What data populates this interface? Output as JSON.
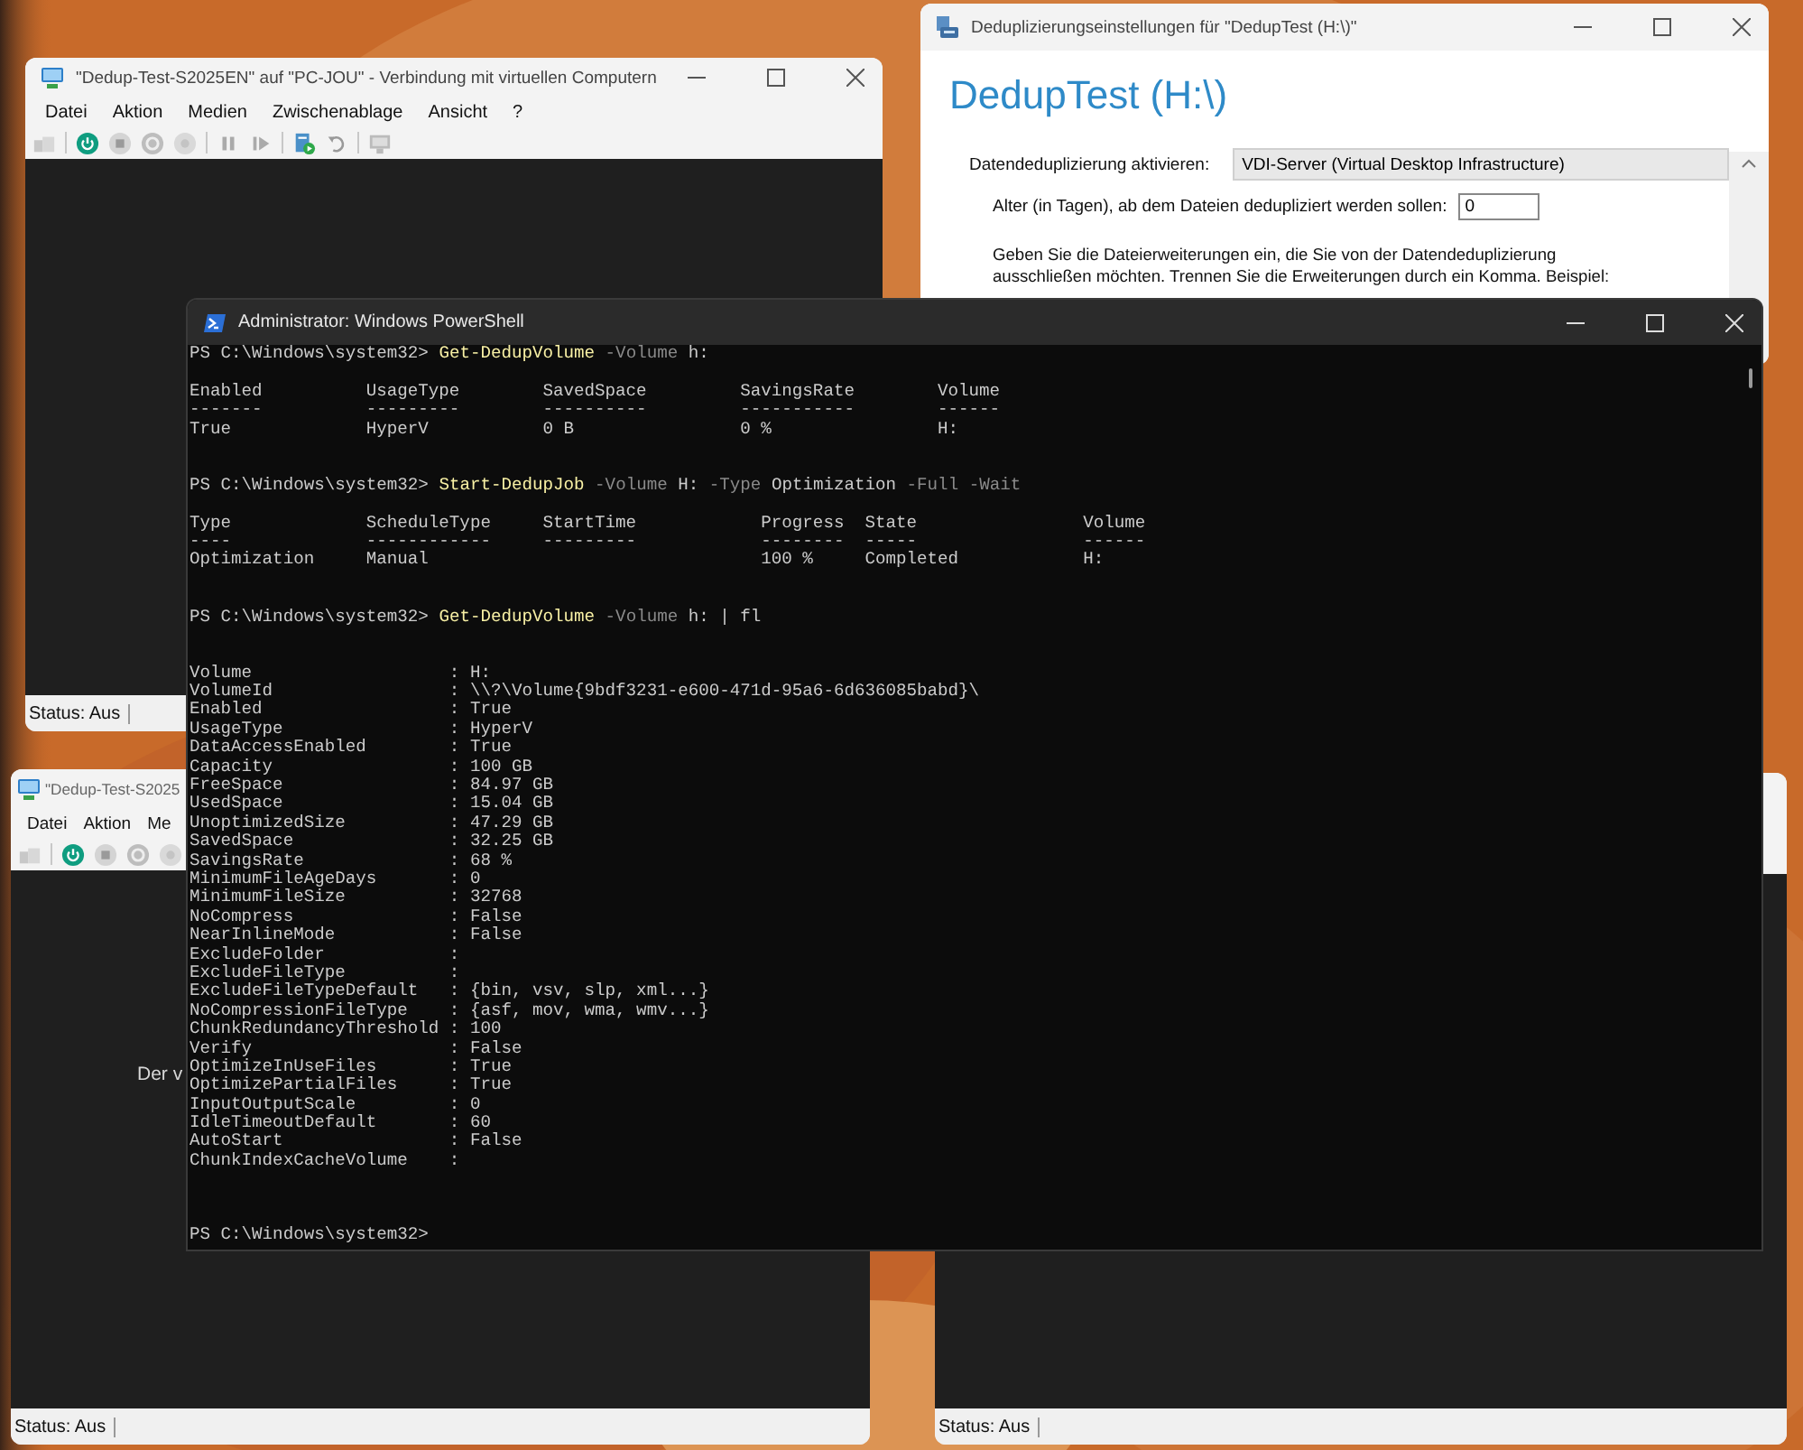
{
  "vm_top": {
    "title": "\"Dedup-Test-S2025EN\" auf \"PC-JOU\" - Verbindung mit virtuellen Computern",
    "menu": [
      "Datei",
      "Aktion",
      "Medien",
      "Zwischenablage",
      "Ansicht",
      "?"
    ],
    "status": "Status: Aus"
  },
  "vm_bottom_left": {
    "title": "\"Dedup-Test-S2025",
    "menu": [
      "Datei",
      "Aktion",
      "Me"
    ],
    "message": "Der v",
    "status": "Status: Aus"
  },
  "vm_bottom_right": {
    "status": "Status: Aus"
  },
  "dedup_settings": {
    "title": "Deduplizierungseinstellungen für \"DedupTest (H:\\)\"",
    "heading": "DedupTest (H:\\)",
    "mode_label": "Datendeduplizierung aktivieren:",
    "mode_value": "VDI-Server (Virtual Desktop Infrastructure)",
    "age_label": "Alter (in Tagen), ab dem Dateien dedupliziert werden sollen:",
    "age_value": "0",
    "help_text": "Geben Sie die Dateierweiterungen ein, die Sie von der Datendeduplizierung\nausschließen möchten. Trennen Sie die Erweiterungen durch ein Komma. Beispiel:"
  },
  "powershell": {
    "title": "Administrator: Windows PowerShell",
    "blocks": [
      {
        "command": [
          {
            "kind": "prompt",
            "text": "PS C:\\Windows\\system32> "
          },
          {
            "kind": "cmdlet",
            "text": "Get-DedupVolume"
          },
          {
            "kind": "param",
            "text": " -Volume"
          },
          {
            "kind": "arg",
            "text": " h:"
          }
        ],
        "output": {
          "kind": "table",
          "lines": [
            "Enabled          UsageType        SavedSpace         SavingsRate        Volume",
            "-------          ---------        ----------         -----------        ------",
            "True             HyperV           0 B                0 %                H:"
          ]
        }
      },
      {
        "command": [
          {
            "kind": "prompt",
            "text": "PS C:\\Windows\\system32> "
          },
          {
            "kind": "cmdlet",
            "text": "Start-DedupJob"
          },
          {
            "kind": "param",
            "text": " -Volume"
          },
          {
            "kind": "arg",
            "text": " H:"
          },
          {
            "kind": "param",
            "text": " -Type"
          },
          {
            "kind": "arg",
            "text": " Optimization"
          },
          {
            "kind": "param",
            "text": " -Full -Wait"
          }
        ],
        "output": {
          "kind": "table",
          "lines": [
            "Type             ScheduleType     StartTime            Progress  State                Volume",
            "----             ------------     ---------            --------  -----                ------",
            "Optimization     Manual                                100 %     Completed            H:"
          ]
        }
      },
      {
        "command": [
          {
            "kind": "prompt",
            "text": "PS C:\\Windows\\system32> "
          },
          {
            "kind": "cmdlet",
            "text": "Get-DedupVolume"
          },
          {
            "kind": "param",
            "text": " -Volume"
          },
          {
            "kind": "arg",
            "text": " h: | fl"
          }
        ],
        "output": {
          "kind": "list",
          "lines": [
            "Volume                   : H:",
            "VolumeId                 : \\\\?\\Volume{9bdf3231-e600-471d-95a6-6d636085babd}\\",
            "Enabled                  : True",
            "UsageType                : HyperV",
            "DataAccessEnabled        : True",
            "Capacity                 : 100 GB",
            "FreeSpace                : 84.97 GB",
            "UsedSpace                : 15.04 GB",
            "UnoptimizedSize          : 47.29 GB",
            "SavedSpace               : 32.25 GB",
            "SavingsRate              : 68 %",
            "MinimumFileAgeDays       : 0",
            "MinimumFileSize          : 32768",
            "NoCompress               : False",
            "NearInlineMode           : False",
            "ExcludeFolder            :",
            "ExcludeFileType          :",
            "ExcludeFileTypeDefault   : {bin, vsv, slp, xml...}",
            "NoCompressionFileType    : {asf, mov, wma, wmv...}",
            "ChunkRedundancyThreshold : 100",
            "Verify                   : False",
            "OptimizeInUseFiles       : True",
            "OptimizePartialFiles     : True",
            "InputOutputScale         : 0",
            "IdleTimeoutDefault       : 60",
            "AutoStart                : False",
            "ChunkIndexCacheVolume    :"
          ]
        }
      }
    ],
    "prompt": "PS C:\\Windows\\system32>"
  }
}
